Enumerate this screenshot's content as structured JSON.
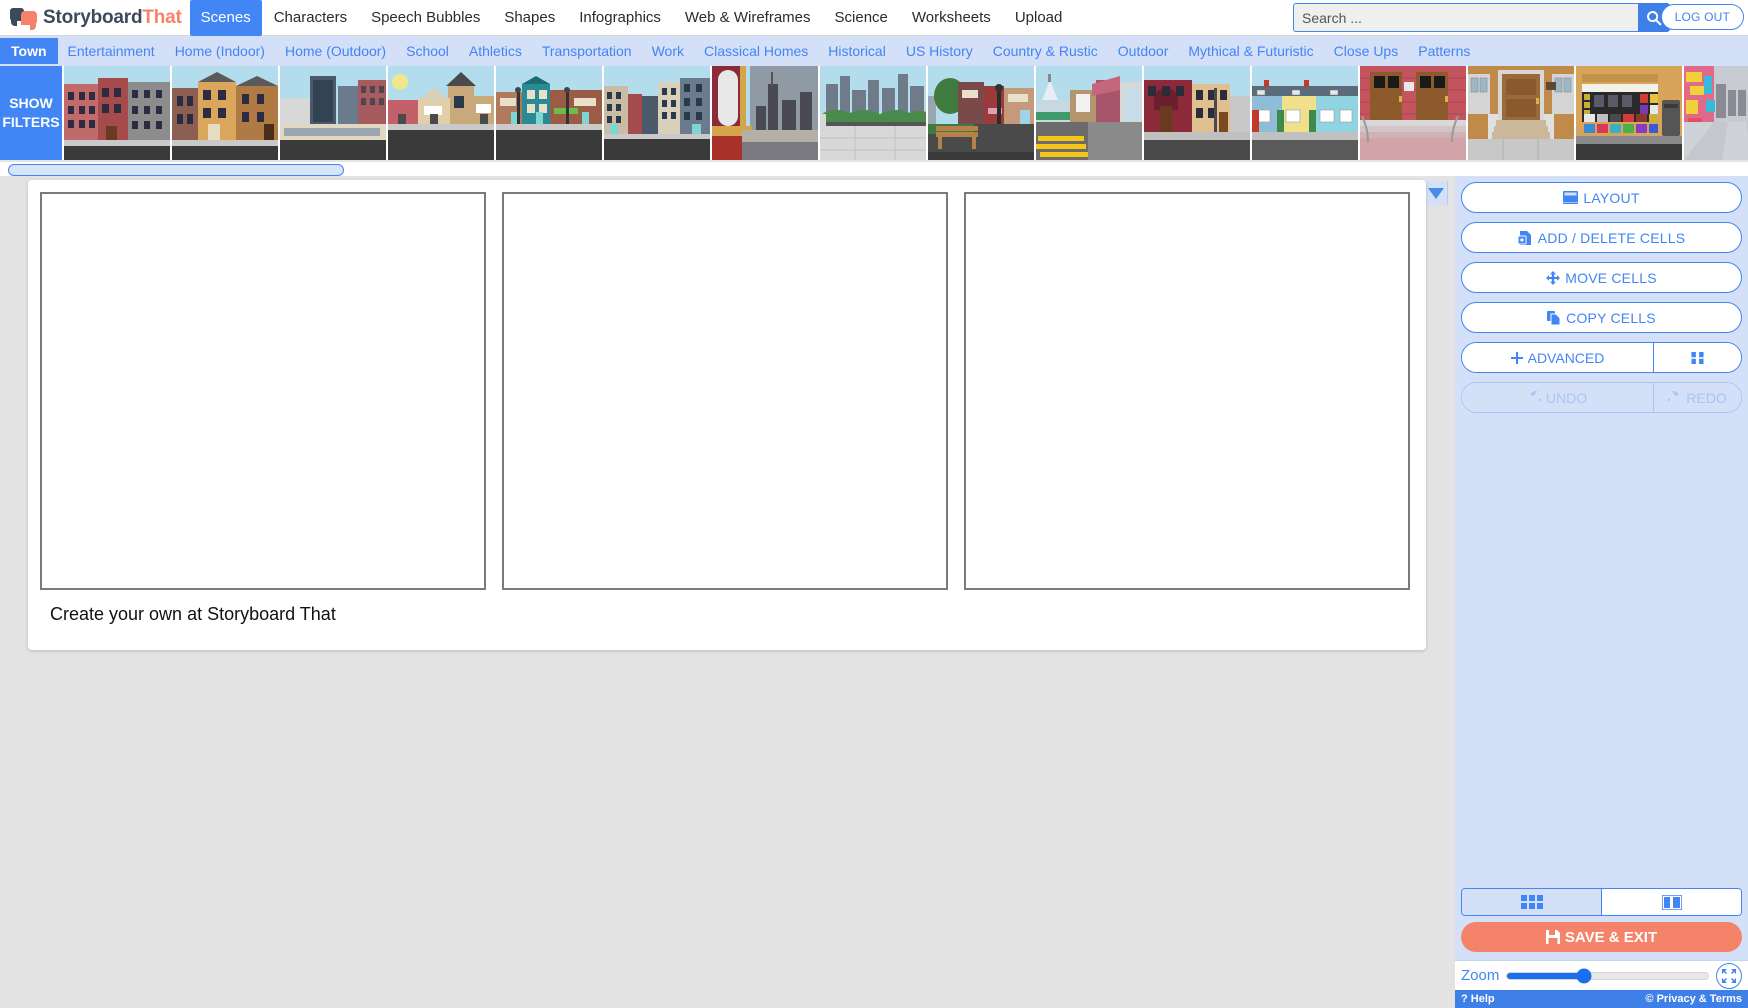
{
  "brand": {
    "part1": "Storyboard",
    "part2": "That"
  },
  "topnav": {
    "items": [
      {
        "label": "Scenes",
        "active": true
      },
      {
        "label": "Characters",
        "active": false
      },
      {
        "label": "Speech Bubbles",
        "active": false
      },
      {
        "label": "Shapes",
        "active": false
      },
      {
        "label": "Infographics",
        "active": false
      },
      {
        "label": "Web & Wireframes",
        "active": false
      },
      {
        "label": "Science",
        "active": false
      },
      {
        "label": "Worksheets",
        "active": false
      },
      {
        "label": "Upload",
        "active": false
      }
    ],
    "search_placeholder": "Search ...",
    "search_value": "",
    "search_icon": "magnifier-icon",
    "logout_label": "LOG OUT"
  },
  "categories": [
    {
      "label": "Town",
      "active": true
    },
    {
      "label": "Entertainment",
      "active": false
    },
    {
      "label": "Home (Indoor)",
      "active": false
    },
    {
      "label": "Home (Outdoor)",
      "active": false
    },
    {
      "label": "School",
      "active": false
    },
    {
      "label": "Athletics",
      "active": false
    },
    {
      "label": "Transportation",
      "active": false
    },
    {
      "label": "Work",
      "active": false
    },
    {
      "label": "Classical Homes",
      "active": false
    },
    {
      "label": "Historical",
      "active": false
    },
    {
      "label": "US History",
      "active": false
    },
    {
      "label": "Country & Rustic",
      "active": false
    },
    {
      "label": "Outdoor",
      "active": false
    },
    {
      "label": "Mythical & Futuristic",
      "active": false
    },
    {
      "label": "Close Ups",
      "active": false
    },
    {
      "label": "Patterns",
      "active": false
    }
  ],
  "filters": {
    "label_line1": "SHOW",
    "label_line2": "FILTERS"
  },
  "thumbnails": [
    {
      "name": "city-brick-apartments"
    },
    {
      "name": "brownstone-row-houses"
    },
    {
      "name": "downtown-modern-buildings"
    },
    {
      "name": "suburban-shops-daytime"
    },
    {
      "name": "main-street-storefronts"
    },
    {
      "name": "city-street-intersection"
    },
    {
      "name": "window-view-skyline"
    },
    {
      "name": "rooftop-city-skyline"
    },
    {
      "name": "park-bench-sidewalk"
    },
    {
      "name": "crosswalk-shop-corner"
    },
    {
      "name": "town-houses-corner"
    },
    {
      "name": "colorful-row-houses"
    },
    {
      "name": "red-brick-double-doors"
    },
    {
      "name": "wooden-front-door-steps"
    },
    {
      "name": "newsstand-kiosk"
    },
    {
      "name": "neon-alley-street"
    }
  ],
  "panel": {
    "collapse_up_icon": "triangle-up-icon",
    "collapse_down_icon": "triangle-down-icon",
    "buttons": [
      {
        "label": "LAYOUT",
        "icon": "layout-icon",
        "disabled": false
      },
      {
        "label": "ADD / DELETE CELLS",
        "icon": "add-cells-icon",
        "disabled": false
      },
      {
        "label": "MOVE CELLS",
        "icon": "move-arrows-icon",
        "disabled": false
      },
      {
        "label": "COPY CELLS",
        "icon": "copy-icon",
        "disabled": false
      }
    ],
    "advanced": {
      "label": "ADVANCED",
      "icon": "plus-icon",
      "extra_icon": "puzzle-icon"
    },
    "undo": {
      "label": "UNDO",
      "icon": "undo-arrow-icon",
      "disabled": true
    },
    "redo": {
      "label": "REDO",
      "icon": "redo-arrow-icon",
      "disabled": true
    },
    "view_grid_icon": "grid-view-icon",
    "view_columns_icon": "column-view-icon",
    "view_selected": "columns",
    "save_exit": {
      "label": "SAVE & EXIT",
      "icon": "floppy-save-icon"
    },
    "zoom": {
      "label": "Zoom",
      "value_percent": 38,
      "fit_icon": "fit-screen-icon"
    },
    "footer": {
      "help": "Help",
      "help_icon": "question-icon",
      "privacy": "Privacy & Terms",
      "privacy_icon": "copyright-icon"
    }
  },
  "storyboard": {
    "caption": "Create your own at Storyboard That",
    "cells": [
      {
        "name": "cell-1"
      },
      {
        "name": "cell-2"
      },
      {
        "name": "cell-3"
      }
    ]
  },
  "colors": {
    "accent_blue": "#4285f4",
    "brand_orange": "#f4836a",
    "panel_bg": "#d3e0f7",
    "workarea_bg": "#e3e3e3",
    "brand_dark": "#3d4a5c"
  }
}
